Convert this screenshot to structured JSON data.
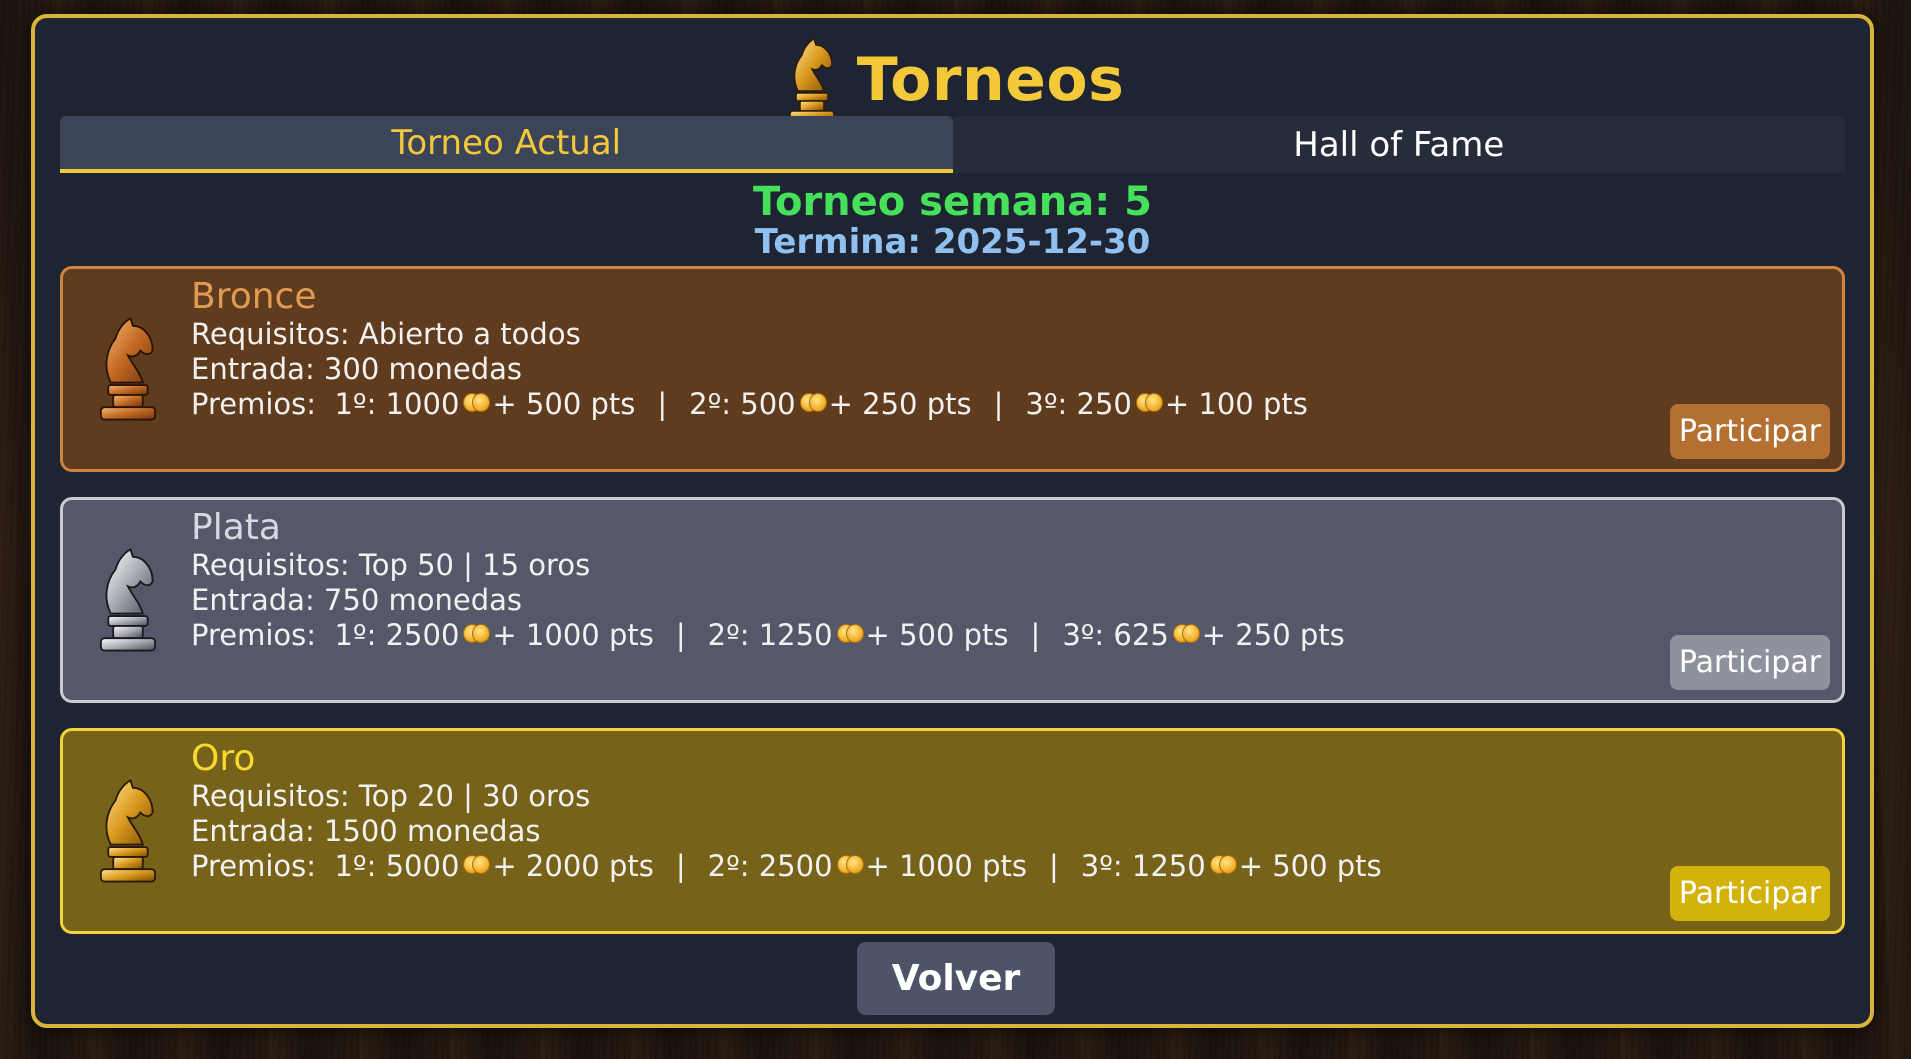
{
  "header": {
    "title": "Torneos",
    "icon": "knight-trophy-icon"
  },
  "tabs": [
    {
      "label": "Torneo Actual",
      "active": true
    },
    {
      "label": "Hall of Fame",
      "active": false
    }
  ],
  "week": {
    "label": "Torneo semana: 5",
    "ends": "Termina: 2025-12-30"
  },
  "tournaments": [
    {
      "name": "Bronce",
      "requirements": "Requisitos: Abierto a todos",
      "entry": "Entrada: 300 monedas",
      "prizes_label": "Premios:",
      "p1": "1º: 1000",
      "p1_pts": "+ 500 pts",
      "p2": "2º: 500",
      "p2_pts": "+ 250 pts",
      "p3": "3º: 250",
      "p3_pts": "+ 100 pts",
      "button": "Participar",
      "color": "#cd8540"
    },
    {
      "name": "Plata",
      "requirements": "Requisitos: Top 50 | 15 oros",
      "entry": "Entrada: 750 monedas",
      "prizes_label": "Premios:",
      "p1": "1º: 2500",
      "p1_pts": "+ 1000 pts",
      "p2": "2º: 1250",
      "p2_pts": "+ 500 pts",
      "p3": "3º: 625",
      "p3_pts": "+ 250 pts",
      "button": "Participar",
      "color": "#c9cbd4"
    },
    {
      "name": "Oro",
      "requirements": "Requisitos: Top 20 | 30 oros",
      "entry": "Entrada: 1500 monedas",
      "prizes_label": "Premios:",
      "p1": "1º: 5000",
      "p1_pts": "+ 2000 pts",
      "p2": "2º: 2500",
      "p2_pts": "+ 1000 pts",
      "p3": "3º: 1250",
      "p3_pts": "+ 500 pts",
      "button": "Participar",
      "color": "#f2d33a"
    }
  ],
  "separator": "|",
  "back_button": "Volver",
  "colors": {
    "accent": "#f3c93a",
    "panel": "#1e2432",
    "week": "#46e05a",
    "ends": "#8fc0f0"
  }
}
